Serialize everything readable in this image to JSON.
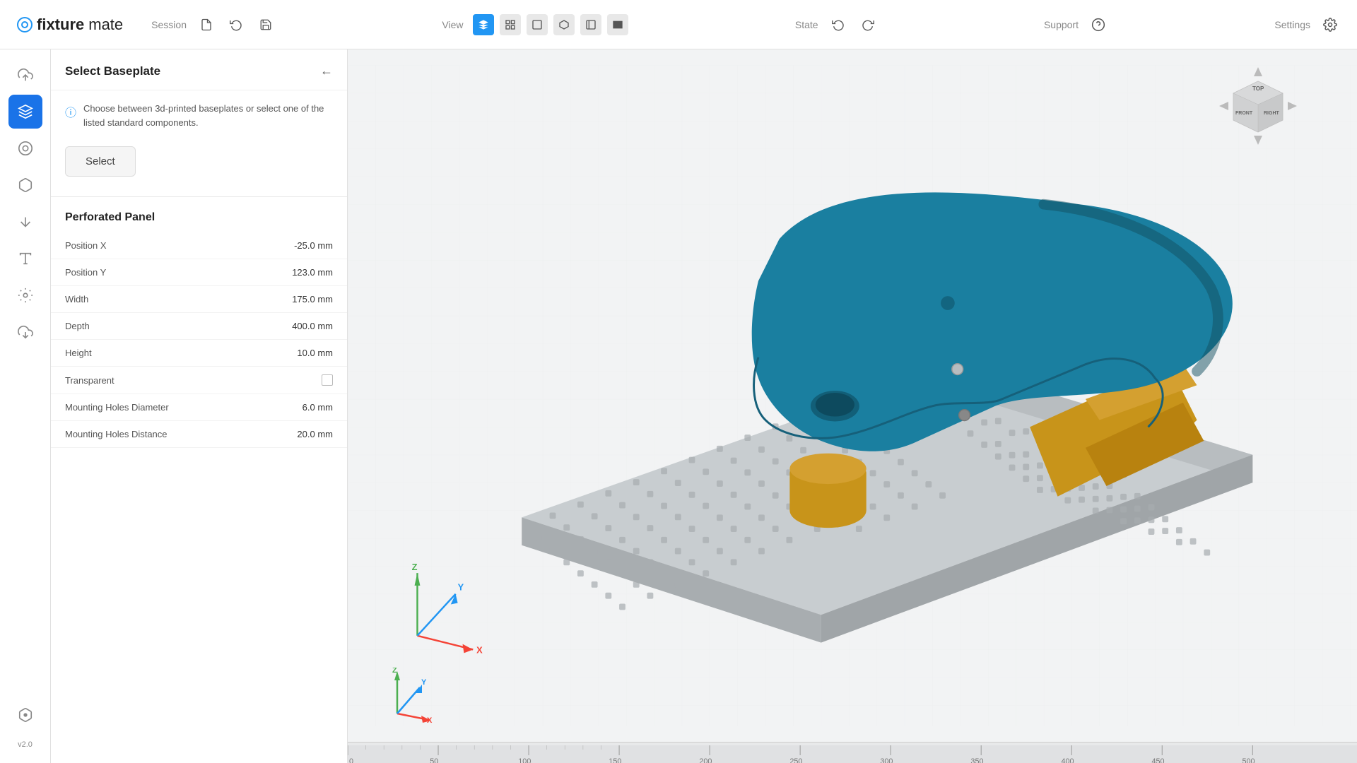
{
  "app": {
    "name_bold": "fixture",
    "name_light": "mate",
    "version": "v2.0"
  },
  "topbar": {
    "session_label": "Session",
    "view_label": "View",
    "state_label": "State",
    "support_label": "Support",
    "settings_label": "Settings",
    "session_icons": [
      "new-file",
      "history",
      "save"
    ],
    "view_icons": [
      "solid-view",
      "fit-view",
      "front-view",
      "right-view",
      "left-view",
      "back-view"
    ]
  },
  "sidebar": {
    "icons": [
      {
        "name": "upload-icon",
        "label": "Upload",
        "active": false
      },
      {
        "name": "layers-icon",
        "label": "Layers",
        "active": true
      },
      {
        "name": "object-icon",
        "label": "Object",
        "active": false
      },
      {
        "name": "part-icon",
        "label": "Part",
        "active": false
      },
      {
        "name": "support-icon",
        "label": "Support",
        "active": false
      },
      {
        "name": "text-icon",
        "label": "Text",
        "active": false
      },
      {
        "name": "fixture-icon",
        "label": "Fixture",
        "active": false
      },
      {
        "name": "download-icon",
        "label": "Download",
        "active": false
      }
    ],
    "bottom_icon": {
      "name": "settings-bottom-icon",
      "label": "Settings"
    }
  },
  "panel": {
    "title": "Select Baseplate",
    "back_icon": "arrow-left",
    "info_text": "Choose between 3d-printed baseplates or select one of the listed standard components.",
    "select_button": "Select",
    "section_title": "Perforated Panel",
    "properties": [
      {
        "label": "Position X",
        "value": "-25.0 mm",
        "type": "text"
      },
      {
        "label": "Position Y",
        "value": "123.0 mm",
        "type": "text"
      },
      {
        "label": "Width",
        "value": "175.0 mm",
        "type": "text"
      },
      {
        "label": "Depth",
        "value": "400.0 mm",
        "type": "text"
      },
      {
        "label": "Height",
        "value": "10.0 mm",
        "type": "text"
      },
      {
        "label": "Transparent",
        "value": "",
        "type": "checkbox"
      },
      {
        "label": "Mounting Holes Diameter",
        "value": "6.0 mm",
        "type": "text"
      },
      {
        "label": "Mounting Holes Distance",
        "value": "20.0 mm",
        "type": "text"
      }
    ]
  },
  "ruler": {
    "marks": [
      "0",
      "50",
      "100",
      "150",
      "200",
      "250",
      "300",
      "350",
      "400",
      "450",
      "500"
    ]
  },
  "colors": {
    "accent": "#1a73e8",
    "active_sidebar": "#1a73e8",
    "part_teal": "#1a7fa0",
    "part_gold": "#c8941a",
    "baseplate_gray": "#c8cdd0"
  }
}
